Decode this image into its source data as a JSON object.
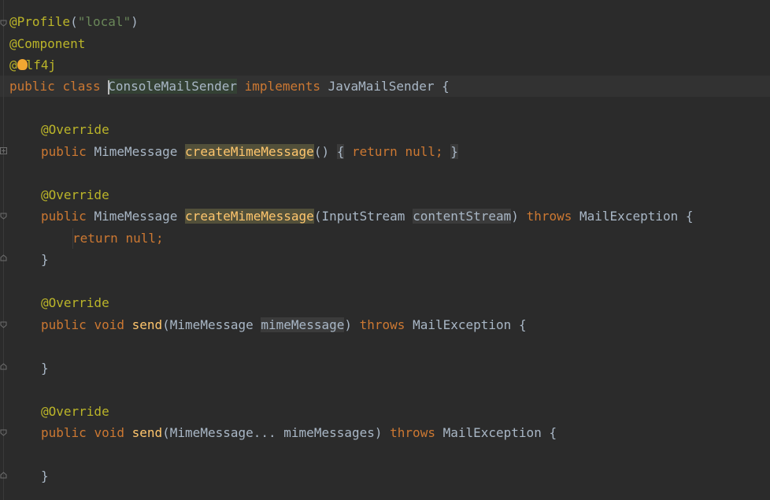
{
  "code": {
    "l1": {
      "ann": "@Profile",
      "open": "(",
      "str": "\"local\"",
      "close": ")"
    },
    "l2": {
      "ann": "@Component"
    },
    "l3": {
      "ann_start": "@",
      "ann_rest": "lf4j"
    },
    "l4": {
      "kw1": "public",
      "kw2": "class",
      "cls": "ConsoleMailSender",
      "kw3": "implements",
      "iface": "JavaMailSender",
      "brace": "{"
    },
    "l6": {
      "ann": "@Override"
    },
    "l7": {
      "kw": "public",
      "type": "MimeMessage",
      "fn": "createMimeMessage",
      "parens": "()",
      "fold_open": "{",
      "ret": "return",
      "nul": "null;",
      "fold_close": "}"
    },
    "l9": {
      "ann": "@Override"
    },
    "l10": {
      "kw": "public",
      "type": "MimeMessage",
      "fn": "createMimeMessage",
      "open": "(",
      "ptype": "InputStream",
      "pname": "contentStream",
      "close": ")",
      "throws": "throws",
      "exc": "MailException",
      "brace": "{"
    },
    "l11": {
      "ret": "return",
      "nul": "null;"
    },
    "l12": {
      "brace": "}"
    },
    "l14": {
      "ann": "@Override"
    },
    "l15": {
      "kw1": "public",
      "kw2": "void",
      "fn": "send",
      "open": "(",
      "ptype": "MimeMessage",
      "pname": "mimeMessage",
      "close": ")",
      "throws": "throws",
      "exc": "MailException",
      "brace": "{"
    },
    "l17": {
      "brace": "}"
    },
    "l19": {
      "ann": "@Override"
    },
    "l20": {
      "kw1": "public",
      "kw2": "void",
      "fn": "send",
      "open": "(",
      "ptype": "MimeMessage...",
      "pname": "mimeMessages",
      "close": ")",
      "throws": "throws",
      "exc": "MailException",
      "brace": "{"
    },
    "l22": {
      "brace": "}"
    }
  },
  "icons": {
    "intention": "lightbulb-icon",
    "fold": "fold-marker-icon"
  },
  "colors": {
    "background": "#2b2b2b",
    "annotation": "#bbb529",
    "keyword": "#cc7832",
    "method": "#ffc66d",
    "string": "#6a8759",
    "text": "#a9b7c6"
  }
}
